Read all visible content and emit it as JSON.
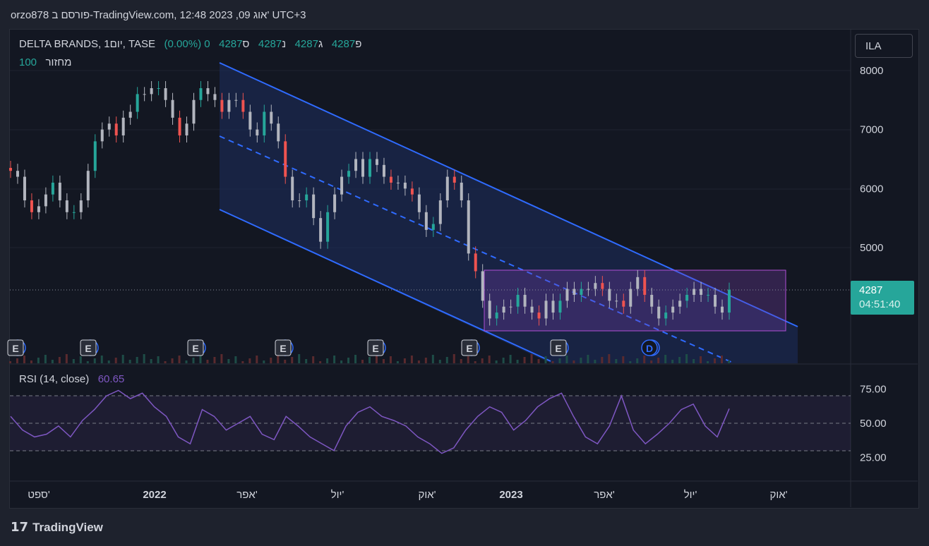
{
  "header": {
    "title": "orzo878 פורסם ב-TradingView.com, 12:48 2023 ,09 אוג' UTC+3"
  },
  "legend": {
    "symbol": "DELTA BRANDS, 1יום, TASE",
    "o_label": "פ",
    "o": "4287",
    "h_label": "ג",
    "h": "4287",
    "l_label": "נ",
    "l": "4287",
    "c_label": "ס",
    "c": "4287",
    "change": "0 (0.00%)",
    "volume_label": "מחזור",
    "volume": "100"
  },
  "currency": "ILA",
  "price_tag": {
    "price": "4287",
    "countdown": "04:51:40"
  },
  "rsi": {
    "label": "RSI (14, close)",
    "value": "60.65"
  },
  "events": [
    "E",
    "E",
    "E",
    "E",
    "E",
    "E",
    "E",
    "D"
  ],
  "logo": "TradingView",
  "chart_data": {
    "type": "candlestick",
    "price_axis": {
      "ticks": [
        8000,
        7000,
        6000,
        5000
      ],
      "range": [
        3300,
        8100
      ]
    },
    "rsi_axis": {
      "ticks": [
        "75.00",
        "50.00",
        "25.00"
      ],
      "band": [
        30,
        70
      ]
    },
    "time_ticks": [
      "ספט'",
      "2022",
      "אפר'",
      "יול'",
      "אוק'",
      "2023",
      "אפר'",
      "יול'",
      "אוק'"
    ],
    "closes": [
      6300,
      6200,
      5800,
      5600,
      5700,
      5900,
      6100,
      5800,
      5600,
      5600,
      5800,
      6300,
      6800,
      7000,
      7100,
      6900,
      7200,
      7300,
      7600,
      7600,
      7700,
      7700,
      7500,
      7200,
      6900,
      7100,
      7500,
      7700,
      7600,
      7500,
      7300,
      7500,
      7500,
      7300,
      7000,
      6900,
      7300,
      7100,
      6800,
      6200,
      5800,
      5800,
      5900,
      5500,
      5100,
      5600,
      5900,
      6200,
      6300,
      6500,
      6200,
      6500,
      6400,
      6200,
      6100,
      6100,
      6000,
      5900,
      5600,
      5300,
      5400,
      5800,
      6200,
      6100,
      5800,
      4900,
      4600,
      4100,
      3800,
      3900,
      4000,
      4000,
      4200,
      4000,
      3900,
      3800,
      4100,
      3900,
      4100,
      4300,
      4200,
      4300,
      4300,
      4400,
      4300,
      4100,
      4100,
      4000,
      4300,
      4500,
      4200,
      4000,
      3800,
      3900,
      4000,
      4100,
      4200,
      4300,
      4200,
      4200,
      4000,
      3900,
      4287
    ],
    "rsi_values": [
      55,
      45,
      40,
      42,
      48,
      40,
      52,
      60,
      70,
      74,
      68,
      72,
      62,
      55,
      40,
      35,
      60,
      55,
      45,
      50,
      55,
      42,
      38,
      55,
      48,
      40,
      35,
      30,
      48,
      58,
      62,
      55,
      52,
      48,
      40,
      35,
      28,
      32,
      45,
      55,
      62,
      58,
      45,
      52,
      62,
      68,
      72,
      55,
      40,
      35,
      48,
      70,
      45,
      35,
      42,
      50,
      60,
      64,
      48,
      40,
      60.65
    ]
  }
}
